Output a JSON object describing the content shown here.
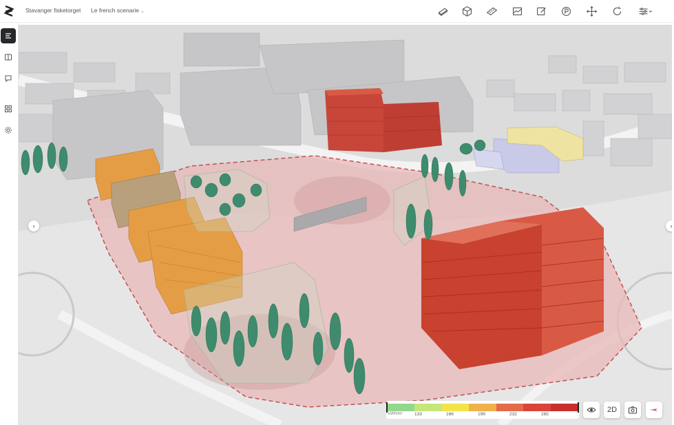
{
  "header": {
    "project_name": "Stavanger fisketorget",
    "scenario_name": "Le french scenarie"
  },
  "toolbar": {
    "tools": [
      {
        "name": "building-tool-icon"
      },
      {
        "name": "cube-tool-icon"
      },
      {
        "name": "measure-tool-icon"
      },
      {
        "name": "terrain-tool-icon"
      },
      {
        "name": "annotate-tool-icon"
      },
      {
        "name": "parking-tool-icon"
      },
      {
        "name": "move-tool-icon"
      },
      {
        "name": "rotate-tool-icon"
      },
      {
        "name": "settings-sliders-icon"
      }
    ]
  },
  "sidebar": {
    "items": [
      {
        "name": "layers-list-icon",
        "active": true
      },
      {
        "name": "book-icon",
        "active": false
      },
      {
        "name": "comment-icon",
        "active": false
      },
      {
        "name": "dashboard-icon",
        "active": false
      },
      {
        "name": "settings-gear-icon",
        "active": false
      }
    ]
  },
  "legend": {
    "unit": "kWh/m²",
    "ticks": [
      "133",
      "166",
      "199",
      "232",
      "265"
    ],
    "colors": [
      "#90d98c",
      "#c6e57a",
      "#f2e34a",
      "#f0b04a",
      "#e36a4a",
      "#d9453b",
      "#c9302c"
    ]
  },
  "view_controls": {
    "toggle_2d_label": "2D"
  },
  "colors": {
    "orange_building": "#e59d45",
    "red_building": "#d85a45",
    "tree": "#3f8b6e",
    "site_zone": "#e8b8b8"
  }
}
